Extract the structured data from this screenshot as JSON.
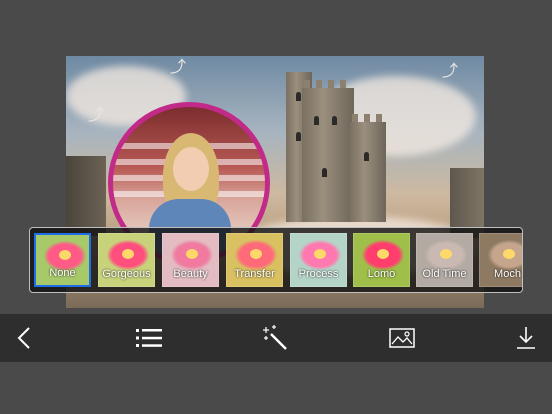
{
  "filters": {
    "items": [
      {
        "label": "None",
        "selected": true,
        "tint": "#ff5b86",
        "bg": "#a7c96a"
      },
      {
        "label": "Gorgeous",
        "selected": false,
        "tint": "#ff4f7e",
        "bg": "#c8d27a"
      },
      {
        "label": "Beauty",
        "selected": false,
        "tint": "#f07aa0",
        "bg": "#e2bcc0"
      },
      {
        "label": "Transfer",
        "selected": false,
        "tint": "#ff6a7a",
        "bg": "#d9c060"
      },
      {
        "label": "Process",
        "selected": false,
        "tint": "#ff79b0",
        "bg": "#b5d4c8"
      },
      {
        "label": "Lomo",
        "selected": false,
        "tint": "#ff3e6e",
        "bg": "#9fbf4a"
      },
      {
        "label": "Old Time",
        "selected": false,
        "tint": "#c9b9b2",
        "bg": "#b3aba3"
      },
      {
        "label": "Moch",
        "selected": false,
        "tint": "#c6a58d",
        "bg": "#8e7a62"
      }
    ]
  },
  "toolbar": {
    "icons": [
      "back-icon",
      "list-icon",
      "magic-wand-icon",
      "image-icon",
      "download-icon"
    ]
  },
  "colors": {
    "selection": "#1e6ee8",
    "frame": "#c22a8a",
    "toolbar_bg": "#2e2e2e",
    "page_bg": "#4a4a4a"
  }
}
